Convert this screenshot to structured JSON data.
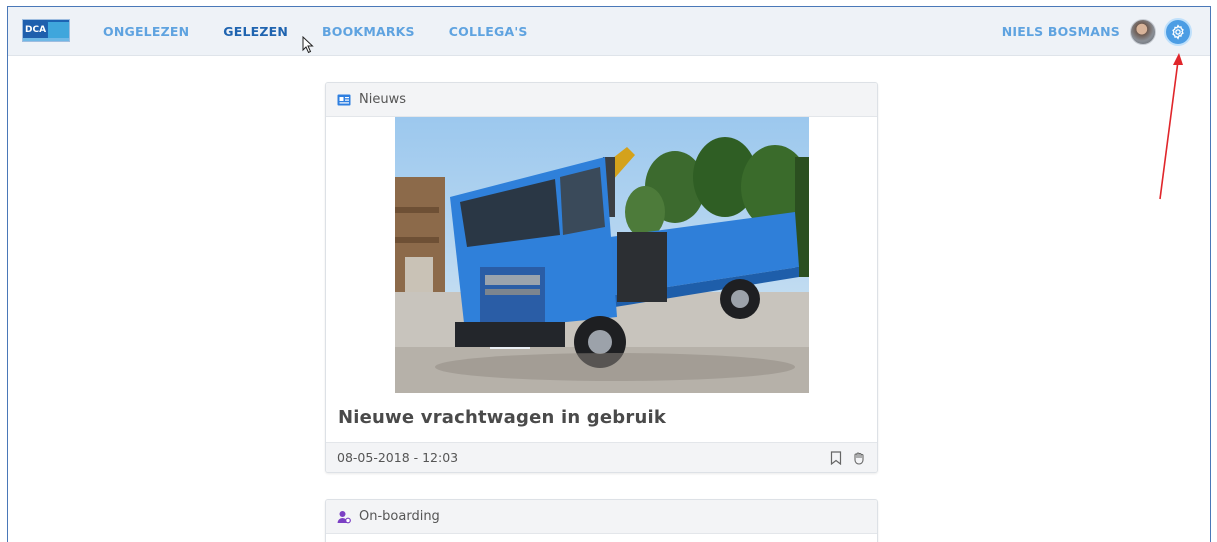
{
  "nav": {
    "items": [
      {
        "label": "ONGELEZEN",
        "active": false
      },
      {
        "label": "GELEZEN",
        "active": true
      },
      {
        "label": "BOOKMARKS",
        "active": false
      },
      {
        "label": "COLLEGA'S",
        "active": false
      }
    ]
  },
  "user": {
    "name": "NIELS BOSMANS"
  },
  "icons": {
    "logo": "dca-logo",
    "settings": "gear-icon",
    "avatar": "user-photo"
  },
  "logo": {
    "text": "DCA"
  },
  "posts": [
    {
      "category": "Nieuws",
      "category_icon": "newspaper-icon",
      "title": "Nieuwe vrachtwagen in gebruik",
      "date": "08-05-2018 - 12:03",
      "actions": [
        "bookmark-icon",
        "hand-icon"
      ]
    },
    {
      "category": "On-boarding",
      "category_icon": "user-settings-icon"
    }
  ],
  "colors": {
    "accent": "#1f64b0",
    "nav": "#5fa3e0",
    "topbar": "#eef2f7",
    "annotation": "#e0262b"
  }
}
